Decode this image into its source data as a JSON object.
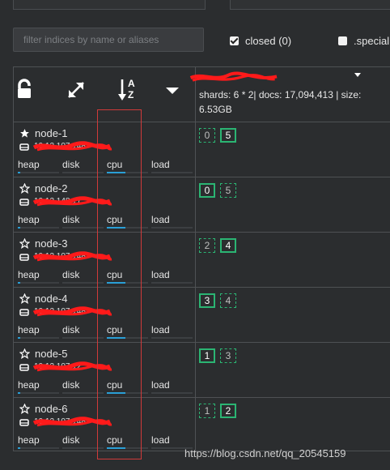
{
  "filter": {
    "placeholder": "filter indices by name or aliases",
    "value": ""
  },
  "options": {
    "closed": {
      "label": "closed (0)",
      "checked": true
    },
    "special": {
      "label": ".special",
      "checked": false
    }
  },
  "toolbar": {
    "icons": [
      "unlock-icon",
      "expand-icon",
      "sort-az-icon",
      "caret-down-icon"
    ],
    "sort_letter_a": "A",
    "sort_letter_z": "Z"
  },
  "index": {
    "info": "shards: 6 * 2| docs: 17,094,413 | size: 6.53GB"
  },
  "metric_labels": {
    "heap": "heap",
    "disk": "disk",
    "cpu": "cpu",
    "load": "load"
  },
  "nodes": [
    {
      "name": "node-1",
      "ip": "10.12.107.148",
      "master": true,
      "shards": [
        {
          "id": "0",
          "primary": false
        },
        {
          "id": "5",
          "primary": true
        }
      ],
      "heap": 0.05,
      "disk": 0.0,
      "cpu": 0.45,
      "load": 0.0
    },
    {
      "name": "node-2",
      "ip": "10.12.148.17",
      "master": false,
      "shards": [
        {
          "id": "0",
          "primary": true
        },
        {
          "id": "5",
          "primary": false
        }
      ],
      "heap": 0.05,
      "disk": 0.0,
      "cpu": 0.45,
      "load": 0.0
    },
    {
      "name": "node-3",
      "ip": "10.12.107.148",
      "master": false,
      "shards": [
        {
          "id": "2",
          "primary": false
        },
        {
          "id": "4",
          "primary": true
        }
      ],
      "heap": 0.05,
      "disk": 0.0,
      "cpu": 0.45,
      "load": 0.0
    },
    {
      "name": "node-4",
      "ip": "10.12.107.148",
      "master": false,
      "shards": [
        {
          "id": "3",
          "primary": true
        },
        {
          "id": "4",
          "primary": false
        }
      ],
      "heap": 0.05,
      "disk": 0.0,
      "cpu": 0.45,
      "load": 0.0
    },
    {
      "name": "node-5",
      "ip": "10.12.107.12",
      "master": false,
      "shards": [
        {
          "id": "1",
          "primary": true
        },
        {
          "id": "3",
          "primary": false
        }
      ],
      "heap": 0.05,
      "disk": 0.0,
      "cpu": 0.45,
      "load": 0.0
    },
    {
      "name": "node-6",
      "ip": "10.12.107.148",
      "master": false,
      "shards": [
        {
          "id": "1",
          "primary": false
        },
        {
          "id": "2",
          "primary": true
        }
      ],
      "heap": 0.05,
      "disk": 0.0,
      "cpu": 0.45,
      "load": 0.0
    }
  ],
  "watermark": "https://blog.csdn.net/qq_20545159",
  "colors": {
    "primary_shard": "#2bb573",
    "bar_fill": "#2a9fd6",
    "annotation": "#d03a3a",
    "scribble": "#ff1a1a"
  }
}
